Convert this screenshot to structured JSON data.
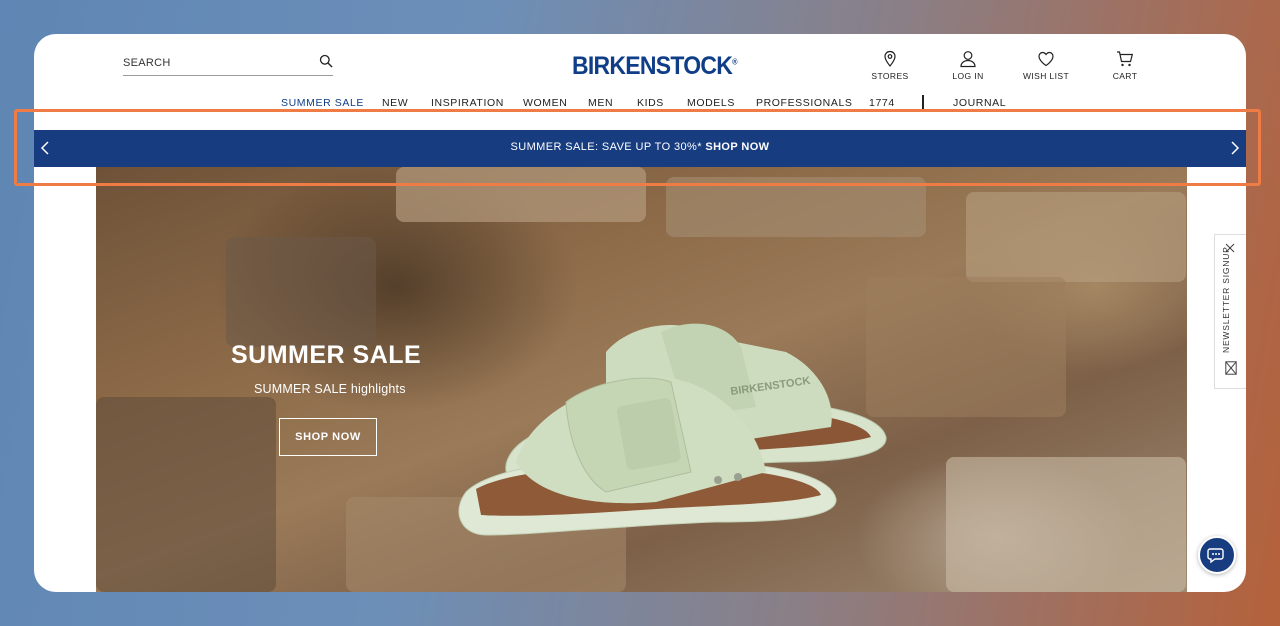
{
  "header": {
    "search_label": "SEARCH",
    "logo": "BIRKENSTOCK",
    "logo_mark": "®",
    "utilities": [
      {
        "label": "STORES",
        "icon": "location-pin-icon"
      },
      {
        "label": "LOG IN",
        "icon": "user-icon"
      },
      {
        "label": "WISH LIST",
        "icon": "heart-icon"
      },
      {
        "label": "CART",
        "icon": "cart-icon"
      }
    ]
  },
  "nav": {
    "items": [
      {
        "label": "SUMMER SALE",
        "active": true
      },
      {
        "label": "NEW"
      },
      {
        "label": "INSPIRATION"
      },
      {
        "label": "WOMEN"
      },
      {
        "label": "MEN"
      },
      {
        "label": "KIDS"
      },
      {
        "label": "MODELS"
      },
      {
        "label": "PROFESSIONALS"
      },
      {
        "label": "1774"
      },
      {
        "label": "JOURNAL"
      }
    ]
  },
  "promo": {
    "text": "SUMMER SALE: SAVE UP TO 30%*",
    "cta": "SHOP NOW"
  },
  "hero": {
    "title": "SUMMER SALE",
    "subtitle": "SUMMER SALE highlights",
    "button": "SHOP NOW",
    "product_brand": "BIRKENSTOCK"
  },
  "newsletter": {
    "label": "NEWSLETTER SIGNUP"
  },
  "colors": {
    "brand": "#0f3d87",
    "promo_bg": "#173c80",
    "highlight": "#ef7b45"
  }
}
